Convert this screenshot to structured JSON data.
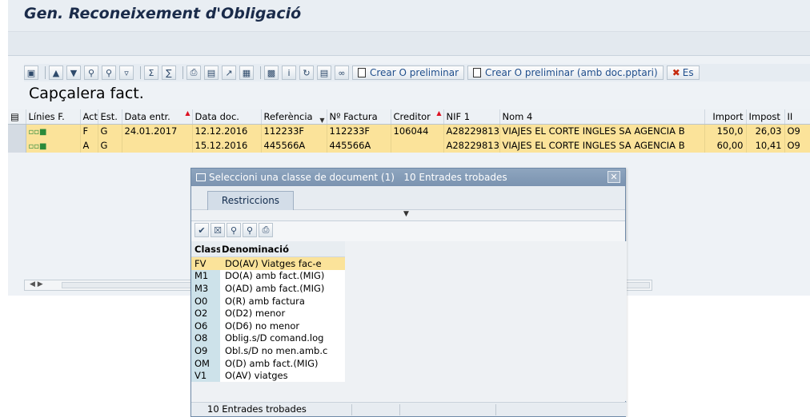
{
  "window": {
    "title": "Gen. Reconeixement d'Obligació"
  },
  "toolbar": {
    "icons": [
      "details-icon",
      "sort-ascending-icon",
      "sort-descending-icon",
      "find-icon",
      "find-next-icon",
      "filter-icon",
      "sum-icon",
      "subtotal-icon",
      "print-icon",
      "print-preview-icon",
      "export-icon",
      "layout-icon",
      "graphic-icon",
      "info-icon",
      "refresh-icon",
      "abc-analysis-icon",
      "link-icon"
    ],
    "create_preliminary_label": "Crear O preliminar",
    "create_preliminary_budget_label": "Crear O preliminar (amb doc.pptari)",
    "delete_label": "Es"
  },
  "section": {
    "title": "Capçalera fact."
  },
  "grid": {
    "columns": [
      "Línies F.",
      "Act.",
      "Est.",
      "Data entr.",
      "Data doc.",
      "Referència",
      "Nº Factura",
      "Creditor",
      "NIF 1",
      "Nom 4",
      "Import",
      "Impost",
      "II"
    ],
    "rows": [
      {
        "lines": "icon",
        "act": "F",
        "est": "G",
        "entry_date": "24.01.2017",
        "doc_date": "12.12.2016",
        "reference": "112233F",
        "invoice": "112233F",
        "creditor": "106044",
        "nif": "A28229813",
        "name": "VIAJES EL CORTE INGLES SA AGENCIA B",
        "amount": "150,0",
        "tax": "26,03",
        "ii": "O9"
      },
      {
        "lines": "icon",
        "act": "A",
        "est": "G",
        "entry_date": "",
        "doc_date": "15.12.2016",
        "reference": "445566A",
        "invoice": "445566A",
        "creditor": "",
        "nif": "A28229813",
        "name": "VIAJES EL CORTE INGLES SA AGENCIA B",
        "amount": "60,00",
        "tax": "10,41",
        "ii": "O9"
      }
    ]
  },
  "dialog": {
    "title": "Seleccioni una classe de document (1)   10 Entrades trobades",
    "tab": "Restriccions",
    "header": {
      "class": "Classe",
      "denomination": "Denominació"
    },
    "items": [
      {
        "class": "FV",
        "name": "DO(AV) Viatges fac-e"
      },
      {
        "class": "M1",
        "name": "DO(A) amb fact.(MIG)"
      },
      {
        "class": "M3",
        "name": "O(AD) amb fact.(MIG)"
      },
      {
        "class": "O0",
        "name": "O(R) amb factura"
      },
      {
        "class": "O2",
        "name": "O(D2) menor"
      },
      {
        "class": "O6",
        "name": "O(D6) no menor"
      },
      {
        "class": "O8",
        "name": "Oblig.s/D comand.log"
      },
      {
        "class": "O9",
        "name": "Obl.s/D no men.amb.c"
      },
      {
        "class": "OM",
        "name": "O(D) amb fact.(MIG)"
      },
      {
        "class": "V1",
        "name": "O(AV) viatges"
      }
    ],
    "status": "10 Entrades trobades"
  },
  "colors": {
    "selected_row": "#fbe39a",
    "title": "#1a2b4a",
    "link": "#1f4e8c"
  }
}
